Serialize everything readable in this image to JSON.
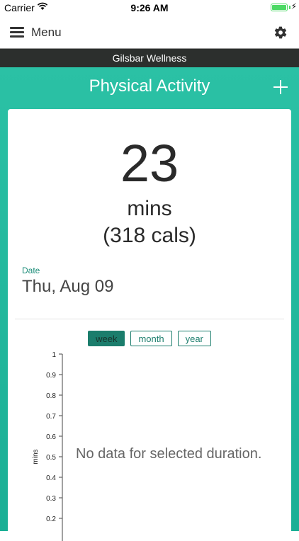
{
  "status_bar": {
    "carrier": "Carrier",
    "time": "9:26 AM",
    "battery_level": 1.0
  },
  "nav": {
    "menu_label": "Menu",
    "menu_icon": "hamburger-icon",
    "settings_icon": "gear-icon"
  },
  "brand": "Gilsbar Wellness",
  "page": {
    "title": "Physical Activity",
    "add_icon": "plus-icon"
  },
  "summary": {
    "value": "23",
    "unit": "mins",
    "calories": "(318 cals)"
  },
  "date": {
    "label": "Date",
    "value": "Thu, Aug 09"
  },
  "range_tabs": [
    {
      "label": "week",
      "active": true
    },
    {
      "label": "month",
      "active": false
    },
    {
      "label": "year",
      "active": false
    }
  ],
  "chart_data": {
    "type": "line",
    "ylabel": "mins",
    "ylim": [
      0,
      1
    ],
    "y_ticks": [
      "1",
      "0.9",
      "0.8",
      "0.7",
      "0.6",
      "0.5",
      "0.4",
      "0.3",
      "0.2"
    ],
    "series": [],
    "empty_message": "No data for selected duration."
  },
  "colors": {
    "accent": "#1fb89c",
    "accent_dark": "#1b7d6c",
    "brand_bar": "#2c2f2d"
  }
}
